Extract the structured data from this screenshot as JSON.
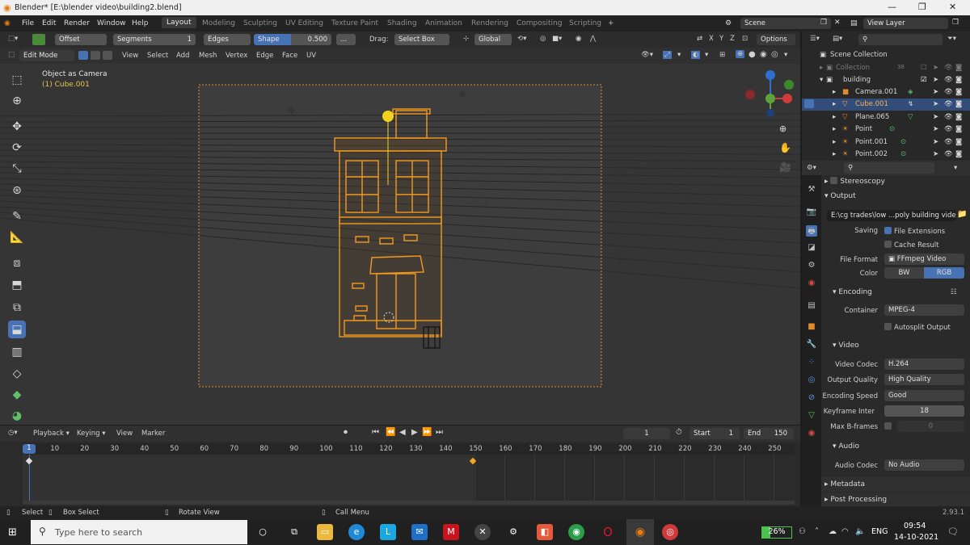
{
  "window": {
    "title": "Blender* [E:\\blender video\\building2.blend]"
  },
  "menu": [
    "File",
    "Edit",
    "Render",
    "Window",
    "Help"
  ],
  "workspaces": [
    "Layout",
    "Modeling",
    "Sculpting",
    "UV Editing",
    "Texture Paint",
    "Shading",
    "Animation",
    "Rendering",
    "Compositing",
    "Scripting"
  ],
  "scene": {
    "name": "Scene",
    "view_layer": "View Layer"
  },
  "tool_header": {
    "offset": "Offset",
    "segments_label": "Segments",
    "segments_value": "1",
    "edges": "Edges",
    "shape_label": "Shape",
    "shape_value": "0.500",
    "dots": "...",
    "drag_label": "Drag:",
    "drag_value": "Select Box",
    "orientation": "Global",
    "options": "Options"
  },
  "mode_header": {
    "mode": "Edit Mode",
    "items": [
      "View",
      "Select",
      "Add",
      "Mesh",
      "Vertex",
      "Edge",
      "Face",
      "UV"
    ]
  },
  "viewport": {
    "title": "Object as Camera",
    "object": "(1) Cube.001"
  },
  "timeline": {
    "menus": [
      "Playback",
      "Keying",
      "View",
      "Marker"
    ],
    "current_frame": "1",
    "start_label": "Start",
    "start": "1",
    "end_label": "End",
    "end": "150",
    "ticks": [
      "1",
      "10",
      "20",
      "30",
      "40",
      "50",
      "60",
      "70",
      "80",
      "90",
      "100",
      "110",
      "120",
      "130",
      "140",
      "150",
      "160",
      "170",
      "180",
      "190",
      "200",
      "210",
      "220",
      "230",
      "240",
      "250"
    ]
  },
  "outliner": {
    "root": "Scene Collection",
    "items": [
      {
        "name": "Collection",
        "badge": "38"
      },
      {
        "name": "building"
      },
      {
        "name": "Camera.001"
      },
      {
        "name": "Cube.001"
      },
      {
        "name": "Plane.065"
      },
      {
        "name": "Point"
      },
      {
        "name": "Point.001"
      },
      {
        "name": "Point.002"
      }
    ]
  },
  "properties": {
    "stereoscopy": "Stereoscopy",
    "output_header": "Output",
    "output_path": "E:\\cg trades\\low ...poly building video",
    "saving_label": "Saving",
    "file_extensions": "File Extensions",
    "cache_result": "Cache Result",
    "file_format_label": "File Format",
    "file_format": "FFmpeg Video",
    "color_label": "Color",
    "color_bw": "BW",
    "color_rgb": "RGB",
    "encoding_header": "Encoding",
    "container_label": "Container",
    "container": "MPEG-4",
    "autosplit": "Autosplit Output",
    "video_header": "Video",
    "video_codec_label": "Video Codec",
    "video_codec": "H.264",
    "output_quality_label": "Output Quality",
    "output_quality": "High Quality",
    "encoding_speed_label": "Encoding Speed",
    "encoding_speed": "Good",
    "keyframe_label": "Keyframe Inter",
    "keyframe_value": "18",
    "max_bframes_label": "Max B-frames",
    "max_bframes_value": "0",
    "audio_header": "Audio",
    "audio_codec_label": "Audio Codec",
    "audio_codec": "No Audio",
    "metadata": "Metadata",
    "post_processing": "Post Processing"
  },
  "statusbar": {
    "select": "Select",
    "box_select": "Box Select",
    "rotate_view": "Rotate View",
    "call_menu": "Call Menu",
    "version": "2.93.1"
  },
  "taskbar": {
    "search_placeholder": "Type here to search",
    "battery": "26%",
    "lang": "ENG",
    "time": "09:54",
    "date": "14-10-2021"
  },
  "colors": {
    "accent": "#4772b3",
    "selection": "#f5a623",
    "viewport": "#3d3d3d"
  }
}
